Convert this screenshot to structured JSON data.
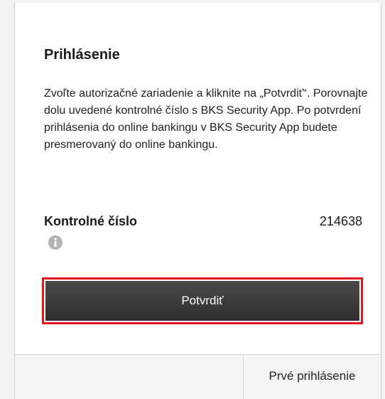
{
  "login_panel": {
    "title": "Prihlásenie",
    "description": "Zvoľte autorizačné zariadenie a kliknite na „Potvrdiť“. Porovnajte dolu uvedené kontrolné číslo s BKS Security App. Po potvrdení prihlásenia do online bankingu v BKS Security App budete presmerovaný do online bankingu.",
    "control_number_label": "Kontrolné číslo",
    "control_number_value": "214638",
    "info_icon": "info-icon",
    "confirm_button_label": "Potvrdiť",
    "first_login_label": "Prvé prihlásenie"
  },
  "colors": {
    "highlight_border": "#e3141b",
    "button_background": "#3b3b3b",
    "button_text": "#ffffff",
    "footer_background": "#f5f5f5",
    "info_icon": "#b3b3b3"
  }
}
